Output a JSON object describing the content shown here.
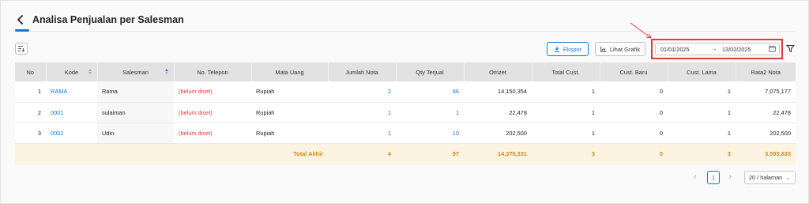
{
  "header": {
    "title": "Analisa Penjualan per Salesman"
  },
  "toolbar": {
    "export_label": "Ekspor",
    "chart_label": "Lihat Grafik",
    "date_start": "01/01/2025",
    "date_end": "13/02/2025",
    "date_arrow": "→"
  },
  "table": {
    "columns": [
      "No",
      "Kode",
      "Salesman",
      "No. Telepon",
      "Mata Uang",
      "Jumlah Nota",
      "Qty Terjual",
      "Omzet",
      "Total Cust.",
      "Cust. Baru",
      "Cust. Lama",
      "Rata2 Nota"
    ],
    "rows": [
      {
        "no": "1",
        "kode": "RAMA",
        "salesman": "Rama",
        "telepon": "(belum diset)",
        "mata_uang": "Rupiah",
        "jumlah_nota": "2",
        "qty": "86",
        "omzet": "14,150,354",
        "total_cust": "1",
        "cust_baru": "0",
        "cust_lama": "1",
        "rata2": "7,075,177"
      },
      {
        "no": "2",
        "kode": "0001",
        "salesman": "sulaiman",
        "telepon": "(belum diset)",
        "mata_uang": "Rupiah",
        "jumlah_nota": "1",
        "qty": "1",
        "omzet": "22,478",
        "total_cust": "1",
        "cust_baru": "0",
        "cust_lama": "1",
        "rata2": "22,478"
      },
      {
        "no": "3",
        "kode": "0002",
        "salesman": "Udin",
        "telepon": "(belum diset)",
        "mata_uang": "Rupiah",
        "jumlah_nota": "1",
        "qty": "10",
        "omzet": "202,500",
        "total_cust": "1",
        "cust_baru": "0",
        "cust_lama": "1",
        "rata2": "202,500"
      }
    ],
    "total": {
      "label": "Total Akhir",
      "jumlah_nota": "4",
      "qty": "97",
      "omzet": "14,375,331",
      "total_cust": "3",
      "cust_baru": "0",
      "cust_lama": "3",
      "rata2": "3,593,833"
    }
  },
  "pagination": {
    "current_page": "1",
    "page_size": "20 / halaman"
  },
  "colors": {
    "accent": "#1976d2",
    "highlight": "#e53935",
    "total_text": "#d38a10",
    "total_bg": "#fdf3e2"
  },
  "icons": [
    "back-icon",
    "column-settings-icon",
    "download-icon",
    "chart-icon",
    "calendar-icon",
    "filter-icon",
    "chevron-left-icon",
    "chevron-right-icon",
    "chevron-down-icon"
  ]
}
